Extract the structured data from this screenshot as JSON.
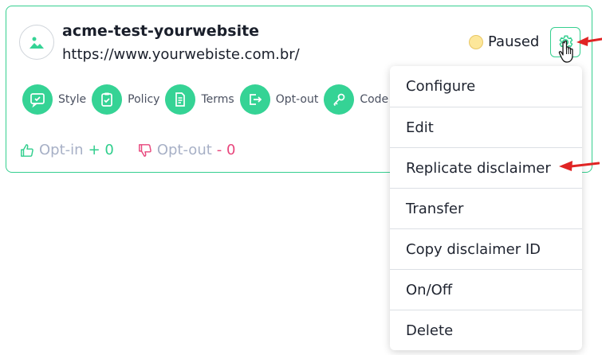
{
  "site": {
    "name": "acme-test-yourwebsite",
    "url": "https://www.yourwebiste.com.br/"
  },
  "status": {
    "label": "Paused",
    "dot_color": "#fde79a"
  },
  "actions": [
    {
      "label": "Style",
      "icon": "chat-check-icon"
    },
    {
      "label": "Policy",
      "icon": "clipboard-check-icon"
    },
    {
      "label": "Terms",
      "icon": "document-icon"
    },
    {
      "label": "Opt-out",
      "icon": "exit-icon"
    },
    {
      "label": "Code",
      "icon": "key-icon"
    }
  ],
  "stats": {
    "optin_label": "Opt-in",
    "optin_value": "+ 0",
    "optout_label": "Opt-out",
    "optout_value": "- 0"
  },
  "menu": {
    "items": [
      "Configure",
      "Edit",
      "Replicate disclaimer",
      "Transfer",
      "Copy disclaimer ID",
      "On/Off",
      "Delete"
    ]
  },
  "colors": {
    "accent": "#35d395",
    "negative": "#e8467c",
    "annotation": "#e02424"
  }
}
